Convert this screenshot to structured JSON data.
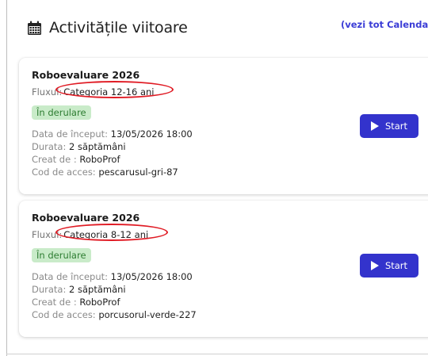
{
  "header": {
    "title": "Activitățile viitoare",
    "see_all_link": "(vezi tot Calendarul"
  },
  "events": [
    {
      "name": "Roboevaluare 2026",
      "flux_label": "Fluxul:",
      "flux_value": "Categoria 12-16 ani",
      "status": "În derulare",
      "start_label": "Data de început:",
      "start_value": "13/05/2026 18:00",
      "duration_label": "Durata:",
      "duration_value": "2 săptămâni",
      "creator_label": "Creat de :",
      "creator_value": "RoboProf",
      "access_label": "Cod de acces:",
      "access_value": "pescarusul-gri-87",
      "button_label": "Start"
    },
    {
      "name": "Roboevaluare 2026",
      "flux_label": "Fluxul:",
      "flux_value": "Categoria 8-12 ani",
      "status": "În derulare",
      "start_label": "Data de început:",
      "start_value": "13/05/2026 18:00",
      "duration_label": "Durata:",
      "duration_value": "2 săptămâni",
      "creator_label": "Creat de :",
      "creator_value": "RoboProf",
      "access_label": "Cod de acces:",
      "access_value": "porcusorul-verde-227",
      "button_label": "Start"
    }
  ],
  "colors": {
    "accent": "#3333cc",
    "link": "#3b3dd6",
    "badge_bg": "#c9ebc9",
    "badge_text": "#2e7d32",
    "annotation": "#e01b24"
  },
  "icons": [
    "calendar-icon",
    "play-icon"
  ]
}
